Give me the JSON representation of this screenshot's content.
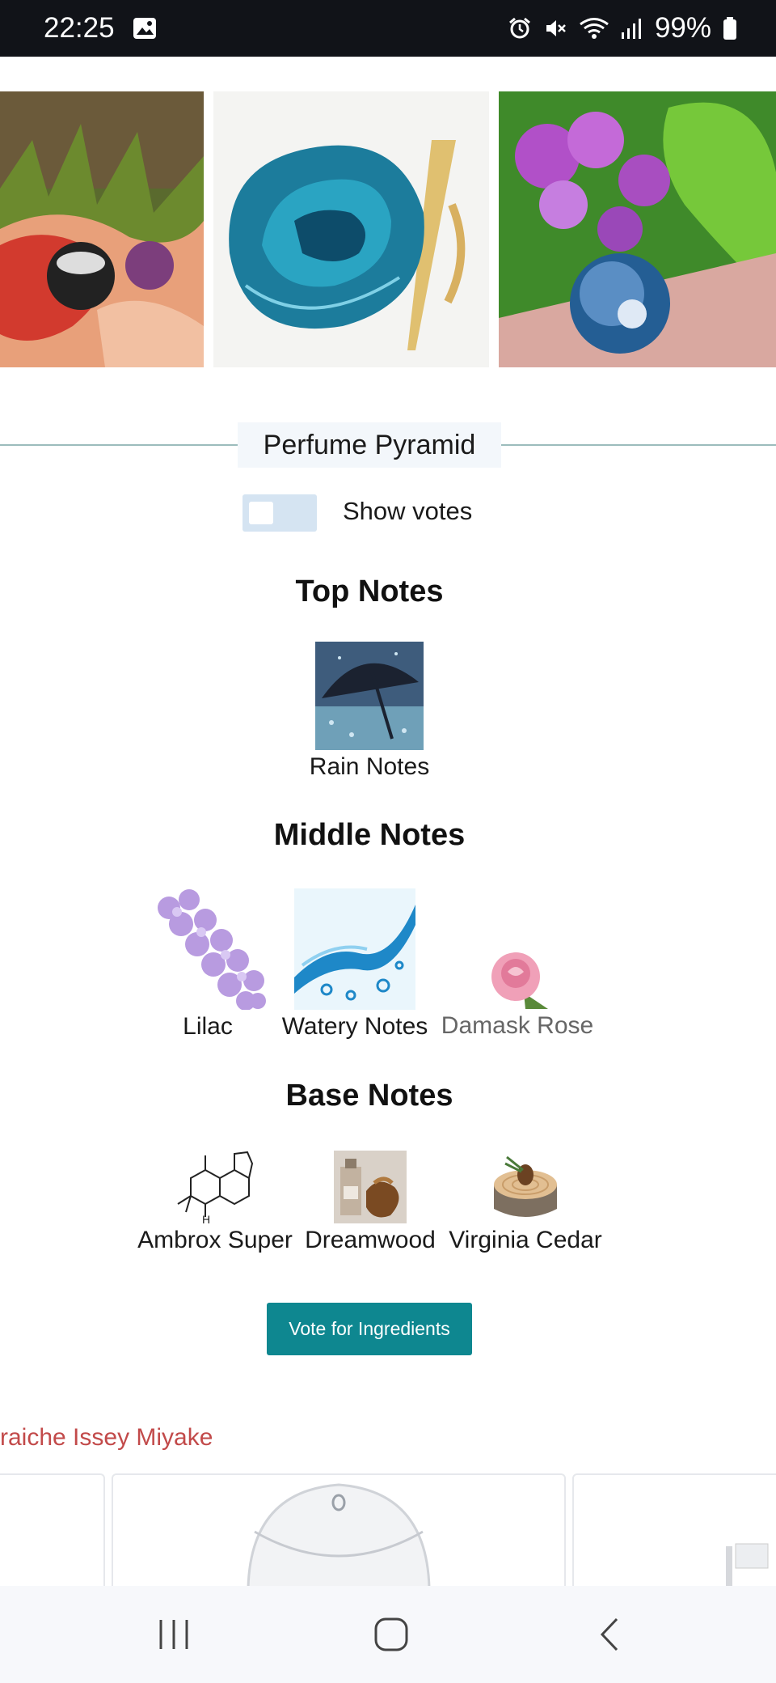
{
  "status_bar": {
    "time": "22:25",
    "battery": "99%",
    "icons": [
      "gallery-icon",
      "alarm-icon",
      "mute-icon",
      "wifi-icon",
      "signal-icon",
      "battery-icon"
    ]
  },
  "gallery": {
    "images": [
      "perfume-with-red-scarf-photo",
      "blue-perfume-bottle-photo",
      "lilac-and-perfume-photo"
    ]
  },
  "pyramid": {
    "title": "Perfume Pyramid",
    "toggle_label": "Show votes",
    "toggle_on": false,
    "top_title": "Top Notes",
    "top_notes": [
      {
        "label": "Rain Notes",
        "icon": "rain-umbrella-image"
      }
    ],
    "middle_title": "Middle Notes",
    "middle_notes": [
      {
        "label": "Lilac",
        "icon": "lilac-image"
      },
      {
        "label": "Watery Notes",
        "icon": "water-splash-image"
      },
      {
        "label": "Damask Rose",
        "icon": "pink-rose-image"
      }
    ],
    "base_title": "Base Notes",
    "base_notes": [
      {
        "label": "Ambrox Super",
        "icon": "molecule-structure-image"
      },
      {
        "label": "Dreamwood",
        "icon": "dreamwood-bottles-image"
      },
      {
        "label": "Virginia Cedar",
        "icon": "cedar-log-image"
      }
    ],
    "vote_button": "Vote for Ingredients"
  },
  "related": {
    "title": "raiche Issey Miyake"
  },
  "colors": {
    "accent": "#0e8790",
    "related_title": "#c24a4a",
    "toggle_track": "#d5e4f2",
    "status_bar_bg": "#111318"
  },
  "nav_bar": {
    "buttons": [
      "recent-apps-icon",
      "home-icon",
      "back-icon"
    ]
  }
}
